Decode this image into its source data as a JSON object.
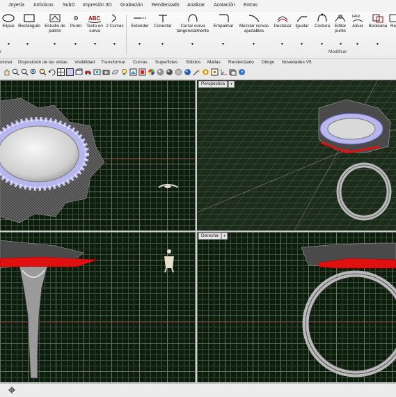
{
  "menu": {
    "items": [
      "Joyería",
      "Artísticos",
      "SubD",
      "Impresión 3D",
      "Grabación",
      "Renderizado",
      "Analizar",
      "Acotación",
      "Extras"
    ]
  },
  "ribbon": {
    "tools": [
      "Elipse",
      "Rectángulo",
      "Estudio de patrón",
      "Punto",
      "Texto en curva",
      "2 Curvas",
      "Extender",
      "Conectar",
      "Cerrar curva tangencialmente",
      "Empalmar",
      "Mezclar curvas ajustables",
      "Desfasar",
      "Igualar",
      "Costura",
      "Editar punto",
      "Alisar",
      "Booleana",
      "Re"
    ],
    "fair_label": "FAIR",
    "abc_label": "ABC",
    "group_left": "r",
    "group_right": "Modificar"
  },
  "tabs": [
    "cionar",
    "Disposición de las vistas",
    "Visibilidad",
    "Transformar",
    "Curvas",
    "Superficies",
    "Sólidos",
    "Mallas",
    "Renderizado",
    "Dibujo",
    "Novedades V5"
  ],
  "viewports": {
    "perspective_label": "Perspectiva",
    "right_label": "Derecha"
  },
  "colors": {
    "viewport_bg": "#0c1d0c",
    "grid_major": "#6a756a",
    "grid_minor": "#3a4a3a",
    "selection_red": "#e01010",
    "gem_ring": "#a8a8e8"
  }
}
